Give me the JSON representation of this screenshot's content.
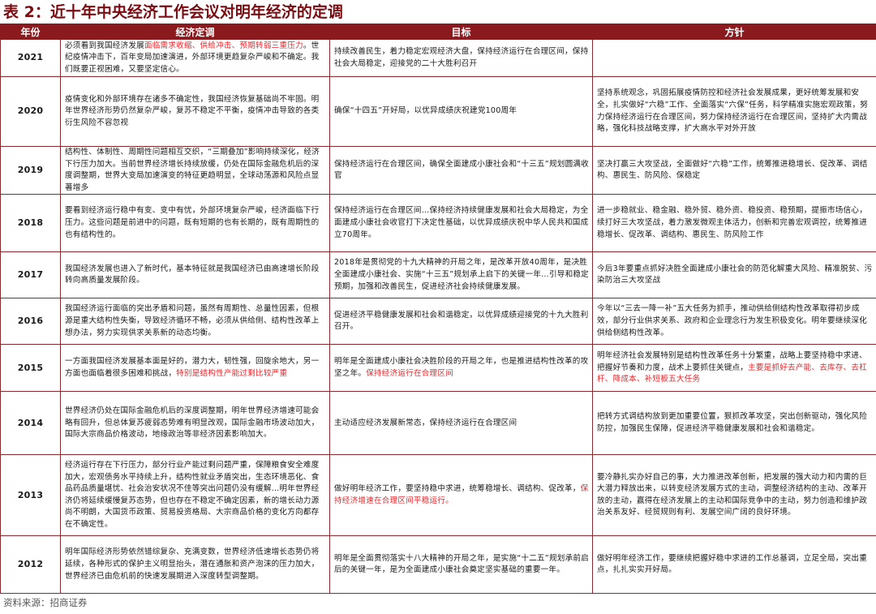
{
  "title": "表 2：近十年中央经济工作会议对明年经济的定调",
  "headers": {
    "year": "年份",
    "tone": "经济定调",
    "goal": "目标",
    "policy": "方针"
  },
  "rows": [
    {
      "year": "2021",
      "tone": [
        {
          "t": "必须看到我国经济发展"
        },
        {
          "t": "面临需求收缩、供给冲击、预期转弱三重压力",
          "red": true
        },
        {
          "t": "。世纪疫情冲击下，百年变局加速演进，外部环境更趋复杂严峻和不确定。我们既要正视困难，又要坚定信心。"
        }
      ],
      "goal": [
        {
          "t": "持续改善民生，着力稳定宏观经济大盘，保持经济运行在合理区间，保持社会大局稳定，迎接党的二十大胜利召开"
        }
      ],
      "policy": []
    },
    {
      "year": "2020",
      "tone": [
        {
          "t": "疫情变化和外部环境存在诸多不确定性，我国经济恢复基础尚不牢固。明年世界经济形势仍然复杂严峻，复苏不稳定不平衡，疫情冲击导致的各类衍生风险不容忽视"
        }
      ],
      "goal": [
        {
          "t": "确保“十四五”开好局，以优异成绩庆祝建党100周年"
        }
      ],
      "policy": [
        {
          "t": "坚持系统观念，巩固拓展疫情防控和经济社会发展成果，更好统筹发展和安全，扎实做好“六稳”工作、全面落实“六保”任务，科学精准实施宏观政策，努力保持经济运行在合理区间，努力保持经济运行在合理区间，坚持扩大内需战略，强化科技战略支撑，扩大高水平对外开放"
        }
      ]
    },
    {
      "year": "2019",
      "tone": [
        {
          "t": "结构性、体制性、周期性问题相互交织，“三期叠加”影响持续深化，经济下行压力加大。当前世界经济增长持续放缓，仍处在国际金融危机后的深度调整期，世界大变局加速演变的特征更趋明显，全球动荡源和风险点显著增多"
        }
      ],
      "goal": [
        {
          "t": "保持经济运行在合理区间，确保全面建成小康社会和“十三五”规划圆满收官"
        }
      ],
      "policy": [
        {
          "t": "坚决打赢三大攻坚战，全面做好“六稳”工作，统筹推进稳增长、促改革、调结构、惠民生、防风险、保稳定"
        }
      ]
    },
    {
      "year": "2018",
      "tone": [
        {
          "t": "要看到经济运行稳中有变、变中有忧，外部环境复杂严峻，经济面临下行压力。这些问题是前进中的问题，既有短期的也有长期的，既有周期性的也有结构性的。"
        }
      ],
      "goal": [
        {
          "t": "保持经济运行在合理区间…保持经济持续健康发展和社会大局稳定，为全面建成小康社会收官打下决定性基础，以优异成绩庆祝中华人民共和国成立70周年。"
        }
      ],
      "policy": [
        {
          "t": "进一步稳就业、稳金融、稳外贸、稳外资、稳投资、稳预期，提振市场信心，续打好三大攻坚战，着力激发微观主体活力，创新和完善宏观调控，统筹推进稳增长、促改革、调结构、惠民生、防风险工作"
        }
      ]
    },
    {
      "year": "2017",
      "tone": [
        {
          "t": "我国经济发展也进入了新时代，基本特征就是我国经济已由高速增长阶段转向高质量发展阶段。"
        }
      ],
      "goal": [
        {
          "t": "2018年是贯彻党的十九大精神的开局之年，是改革开放40周年，是决胜全面建成小康社会、实施“十三五”规划承上启下的关键一年…引导和稳定预期，加强和改善民生，促进经济社会持续健康发展。"
        }
      ],
      "policy": [
        {
          "t": "今后3年要重点抓好决胜全面建成小康社会的防范化解重大风险、精准脱贫、污染防治三大攻坚战"
        }
      ]
    },
    {
      "year": "2016",
      "tone": [
        {
          "t": "我国经济运行面临的突出矛盾和问题，虽然有周期性、总量性因素，但根源是重大结构性失衡，导致经济循环不畅，必须从供给侧、结构性改革上想办法，努力实现供求关系新的动态均衡。"
        }
      ],
      "goal": [
        {
          "t": "促进经济平稳健康发展和社会和谐稳定，以优异成绩迎接党的十九大胜利召开。"
        }
      ],
      "policy": [
        {
          "t": "今年以“三去一降一补”五大任务为抓手，推动供给侧结构性改革取得初步成效，部分行业供求关系、政府和企业理念行为发生积极变化。明年要继续深化供给侧结构性改革。"
        }
      ]
    },
    {
      "year": "2015",
      "tone": [
        {
          "t": "一方面我国经济发展基本面是好的，潜力大，韧性强，回旋余地大，另一方面也面临着很多困难和挑战，"
        },
        {
          "t": "特别是结构性产能过剩比较严重",
          "red": true
        }
      ],
      "goal": [
        {
          "t": "明年是全面建成小康社会决胜阶段的开局之年，也是推进结构性改革的攻坚之年。"
        },
        {
          "t": "保持经济运行在合理区间",
          "red": true
        }
      ],
      "policy": [
        {
          "t": "明年经济社会发展特别是结构性改革任务十分繁重，战略上要坚持稳中求进、把握好节奏和力度，战术上要抓住关键点，"
        },
        {
          "t": "主要是抓好去产能、去库存、去杠杆、降成本、补短板五大任务",
          "red": true
        }
      ]
    },
    {
      "year": "2014",
      "tone": [
        {
          "t": "世界经济仍处在国际金融危机后的深度调整期，明年世界经济增速可能会略有回升，但总体复苏疲弱态势难有明显改观，国际金融市场波动加大，国际大宗商品价格波动，地缘政治等非经济因素影响加大。"
        }
      ],
      "goal": [
        {
          "t": "主动适应经济发展新常态，保持经济运行在合理区间"
        }
      ],
      "policy": [
        {
          "t": "把转方式调结构放到更加重要位置，狠抓改革攻坚，突出创新驱动，强化风险防控，加强民生保障，促进经济平稳健康发展和社会和谐稳定。"
        }
      ]
    },
    {
      "year": "2013",
      "tone": [
        {
          "t": "经济运行存在下行压力，部分行业产能过剩问题严重，保障粮食安全难度加大，宏观债务水平持续上升，结构性就业矛盾突出，生态环境恶化、食品药品质量堪忧、社会治安状况不佳等突出问题仍没有缓解…明年世界经济仍将延续缓慢复苏态势，但也存在不稳定不确定因素，新的增长动力源尚不明朗，大国货币政策、贸易投资格局、大宗商品价格的变化方向都存在不确定性。"
        }
      ],
      "goal": [
        {
          "t": "做好明年经济工作，要坚持稳中求进，统筹稳增长、调结构、促改革，"
        },
        {
          "t": "保持经济增速在合理区间平稳运行。",
          "red": true
        }
      ],
      "policy": [
        {
          "t": "要冷静扎实办好自己的事，大力推进改革创新，把发展的强大动力和内需的巨大潜力释放出来，以转变经济发展方式的主动，调整经济结构的主动、改革开放的主动，赢得在经济发展上的主动和国际竞争中的主动，努力创造和维护政治关系友好、经贸规则有利、发展空间广阔的良好环境。"
        }
      ]
    },
    {
      "year": "2012",
      "tone": [
        {
          "t": "明年国际经济形势依然错综复杂、充满变数，世界经济低速增长态势仍将延续，各种形式的保护主义明显抬头，潜在通胀和资产泡沫的压力加大，世界经济已由危机前的快速发展期进入深度转型调整期。"
        }
      ],
      "goal": [
        {
          "t": "明年是全面贯彻落实十八大精神的开局之年，是实施“十二五”规划承前启后的关键一年，是为全面建成小康社会奠定坚实基础的重要一年。"
        }
      ],
      "policy": [
        {
          "t": "做好明年经济工作，要继续把握好稳中求进的工作总基调，立足全局，突出重点，扎扎实实开好局。"
        }
      ]
    }
  ],
  "source": "资料来源：招商证券"
}
